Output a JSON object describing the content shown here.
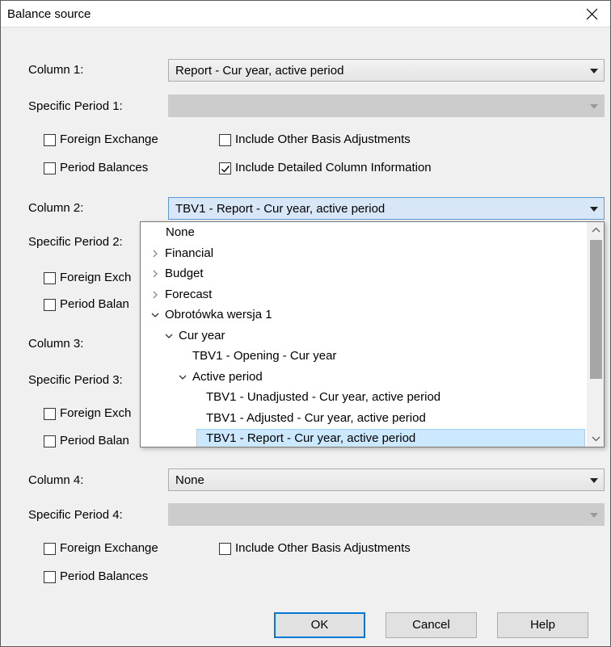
{
  "dialog": {
    "title": "Balance source",
    "close_icon": "close-icon"
  },
  "column1": {
    "label": "Column 1:",
    "value": "Report - Cur year, active period",
    "period_label": "Specific Period 1:",
    "period_value": "",
    "foreign_exchange": {
      "label": "Foreign Exchange",
      "checked": false
    },
    "other_basis": {
      "label": "Include Other Basis Adjustments",
      "checked": false
    },
    "period_balances": {
      "label": "Period Balances",
      "checked": false
    },
    "detailed_info": {
      "label": "Include Detailed Column Information",
      "checked": true
    }
  },
  "column2": {
    "label": "Column 2:",
    "value": "TBV1 - Report - Cur year, active period",
    "period_label": "Specific Period 2:",
    "foreign_exchange": {
      "label": "Foreign Exch",
      "checked": false
    },
    "period_balances": {
      "label": "Period Balan",
      "checked": false
    }
  },
  "column3": {
    "label": "Column 3:",
    "period_label": "Specific Period 3:",
    "foreign_exchange": {
      "label": "Foreign Exch",
      "checked": false
    },
    "period_balances": {
      "label": "Period Balan",
      "checked": false
    }
  },
  "column4": {
    "label": "Column 4:",
    "value": "None",
    "period_label": "Specific Period 4:",
    "period_value": "",
    "foreign_exchange": {
      "label": "Foreign Exchange",
      "checked": false
    },
    "other_basis": {
      "label": "Include Other Basis Adjustments",
      "checked": false
    },
    "period_balances": {
      "label": "Period Balances",
      "checked": false
    }
  },
  "dropdown": {
    "items": [
      {
        "label": "None",
        "expander": "none",
        "level": 0
      },
      {
        "label": "Financial",
        "expander": "collapsed",
        "level": 0
      },
      {
        "label": "Budget",
        "expander": "collapsed",
        "level": 0
      },
      {
        "label": "Forecast",
        "expander": "collapsed",
        "level": 0
      },
      {
        "label": "Obrotówka wersja 1",
        "expander": "expanded",
        "level": 0
      },
      {
        "label": "Cur year",
        "expander": "expanded",
        "level": 1
      },
      {
        "label": "TBV1 - Opening - Cur year",
        "expander": "none",
        "level": 2
      },
      {
        "label": "Active period",
        "expander": "expanded",
        "level": 2
      },
      {
        "label": "TBV1 - Unadjusted - Cur year, active period",
        "expander": "none",
        "level": 3
      },
      {
        "label": "TBV1 - Adjusted - Cur year, active period",
        "expander": "none",
        "level": 3
      },
      {
        "label": "TBV1 - Report - Cur year, active period",
        "expander": "none",
        "level": 3,
        "selected": true
      }
    ]
  },
  "buttons": {
    "ok": "OK",
    "cancel": "Cancel",
    "help": "Help"
  },
  "colors": {
    "focus_border": "#0078d7",
    "selection_bg": "#cce8ff",
    "combo_focus_bg": "#d7e7f7"
  }
}
